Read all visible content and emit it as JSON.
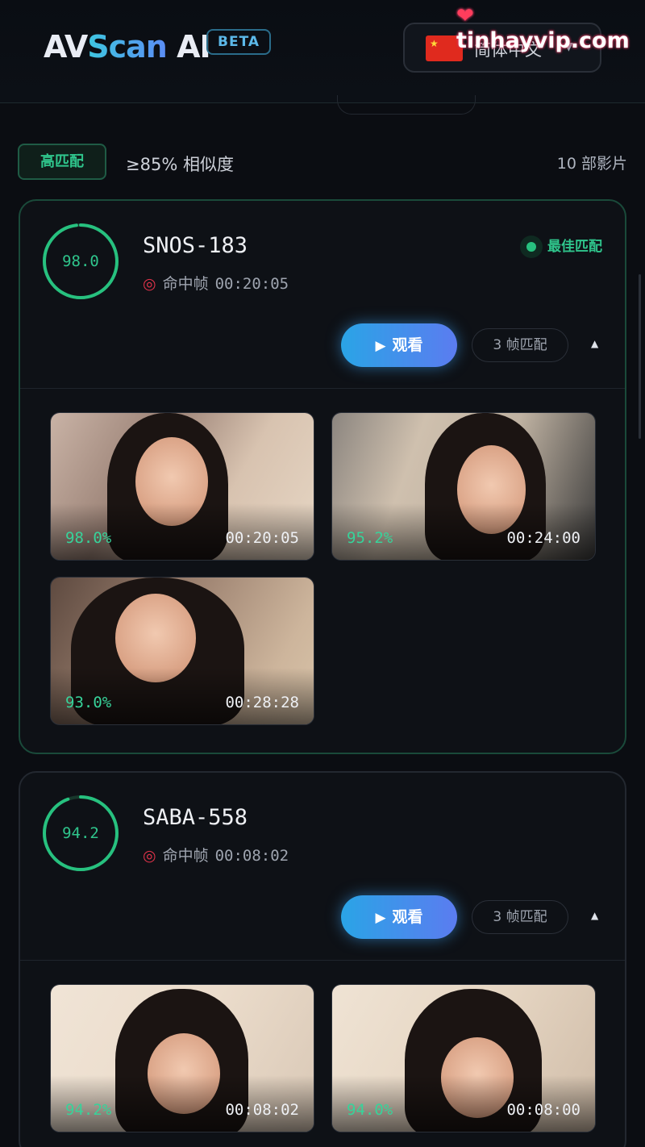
{
  "header": {
    "logo_av": "AV",
    "logo_scan": "Scan",
    "logo_ai": " AI",
    "beta": "BETA",
    "language": "简体中文",
    "watermark": "tinhayvip.com"
  },
  "summary": {
    "badge": "高匹配",
    "similarity": "≥85% 相似度",
    "count": "10  部影片"
  },
  "results": [
    {
      "score": "98.0",
      "score_fraction": 0.98,
      "code": "SNOS-183",
      "hit_label": "命中帧",
      "hit_time": "00:20:05",
      "best_label": "最佳匹配",
      "watch_label": "观看",
      "frames_label": "3  帧匹配",
      "thumbs": [
        {
          "pct": "98.0%",
          "time": "00:20:05"
        },
        {
          "pct": "95.2%",
          "time": "00:24:00"
        },
        {
          "pct": "93.0%",
          "time": "00:28:28"
        }
      ]
    },
    {
      "score": "94.2",
      "score_fraction": 0.942,
      "code": "SABA-558",
      "hit_label": "命中帧",
      "hit_time": "00:08:02",
      "watch_label": "观看",
      "frames_label": "3  帧匹配",
      "thumbs": [
        {
          "pct": "94.2%",
          "time": "00:08:02"
        },
        {
          "pct": "94.0%",
          "time": "00:08:00"
        }
      ]
    }
  ],
  "colors": {
    "accent_green": "#2fc58c",
    "watch_gradient_start": "#2aa4e6",
    "watch_gradient_end": "#5b7cf0"
  }
}
